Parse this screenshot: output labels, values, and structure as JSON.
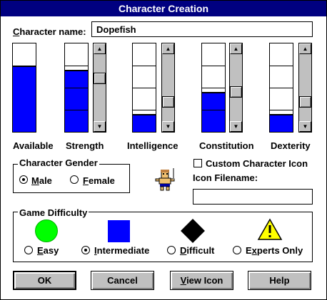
{
  "window": {
    "title": "Character Creation"
  },
  "character_name": {
    "label_accel": "C",
    "label_rest": "haracter name:",
    "value": "Dopefish"
  },
  "stats": [
    {
      "label": "Available",
      "level": 0.75,
      "segments": 0,
      "has_scrollbar": false
    },
    {
      "label": "Strength",
      "level": 0.7,
      "segments": 4,
      "has_scrollbar": true,
      "thumb": 0.33
    },
    {
      "label": "Intelligence",
      "level": 0.2,
      "segments": 4,
      "has_scrollbar": true,
      "thumb": 0.75
    },
    {
      "label": "Constitution",
      "level": 0.45,
      "segments": 4,
      "has_scrollbar": true,
      "thumb": 0.58
    },
    {
      "label": "Dexterity",
      "level": 0.2,
      "segments": 4,
      "has_scrollbar": true,
      "thumb": 0.75
    }
  ],
  "gender": {
    "title": "Character Gender",
    "male": {
      "accel": "M",
      "rest": "ale",
      "checked": true
    },
    "female": {
      "accel": "F",
      "rest": "emale",
      "checked": false
    }
  },
  "custom_icon": {
    "checkbox_label": "Custom Character Icon",
    "checked": false,
    "filename_label": "Icon Filename:",
    "filename_value": ""
  },
  "difficulty": {
    "title": "Game Difficulty",
    "options": [
      {
        "accel": "E",
        "rest": "asy",
        "checked": false,
        "symbol": "green-circle",
        "color": "#00ff00"
      },
      {
        "accel": "I",
        "rest": "ntermediate",
        "checked": true,
        "symbol": "blue-square",
        "color": "#0000ff"
      },
      {
        "accel": "D",
        "rest": "ifficult",
        "checked": false,
        "symbol": "black-diamond",
        "color": "#000000"
      },
      {
        "accel": "x",
        "pre": "E",
        "rest": "perts Only",
        "checked": false,
        "symbol": "warning-triangle",
        "color": "#ffff00"
      }
    ]
  },
  "buttons": {
    "ok": "OK",
    "cancel": "Cancel",
    "view_icon_accel": "V",
    "view_icon_rest": "iew Icon",
    "help": "Help"
  },
  "colors": {
    "titlebar": "#000080",
    "fill": "#0000ff",
    "face": "#c0c0c0"
  }
}
